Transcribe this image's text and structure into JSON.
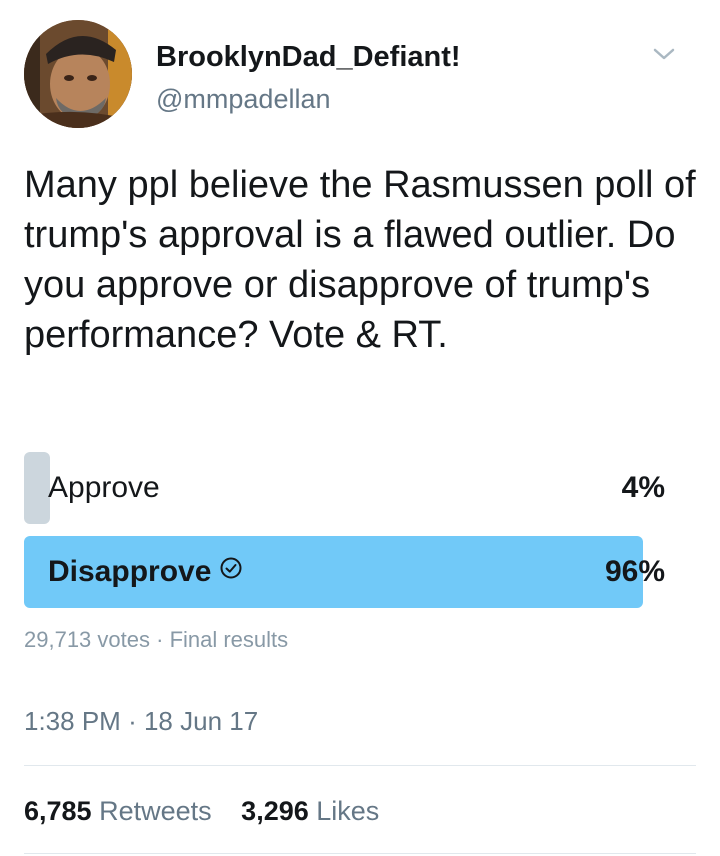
{
  "tweet": {
    "display_name": "BrooklynDad_Defiant!",
    "handle": "@mmpadellan",
    "text": "Many ppl believe the Rasmussen poll of trump's approval is a flawed outlier. Do you approve or disapprove of trump's performance? Vote & RT.",
    "menu_icon": "chevron-down-icon",
    "avatar_icon": "user-avatar"
  },
  "poll": {
    "options": [
      {
        "label": "Approve",
        "percent_text": "4%",
        "percent": 4,
        "color": "#ccd6dd"
      },
      {
        "label": "Disapprove",
        "percent_text": "96%",
        "percent": 96,
        "color": "#71c9f8",
        "winner_icon": "check-circle-icon"
      }
    ],
    "votes": "29,713 votes",
    "separator": "·",
    "status": "Final results"
  },
  "meta": {
    "time": "1:38 PM",
    "separator": "·",
    "date": "18 Jun 17"
  },
  "stats": {
    "retweets_count": "6,785",
    "retweets_label": "Retweets",
    "likes_count": "3,296",
    "likes_label": "Likes"
  },
  "colors": {
    "text": "#14171a",
    "secondary": "#657786",
    "muted": "#8899a6",
    "winner_fill": "#71c9f8",
    "loser_fill": "#ccd6dd",
    "divider": "#e1e8ed"
  }
}
